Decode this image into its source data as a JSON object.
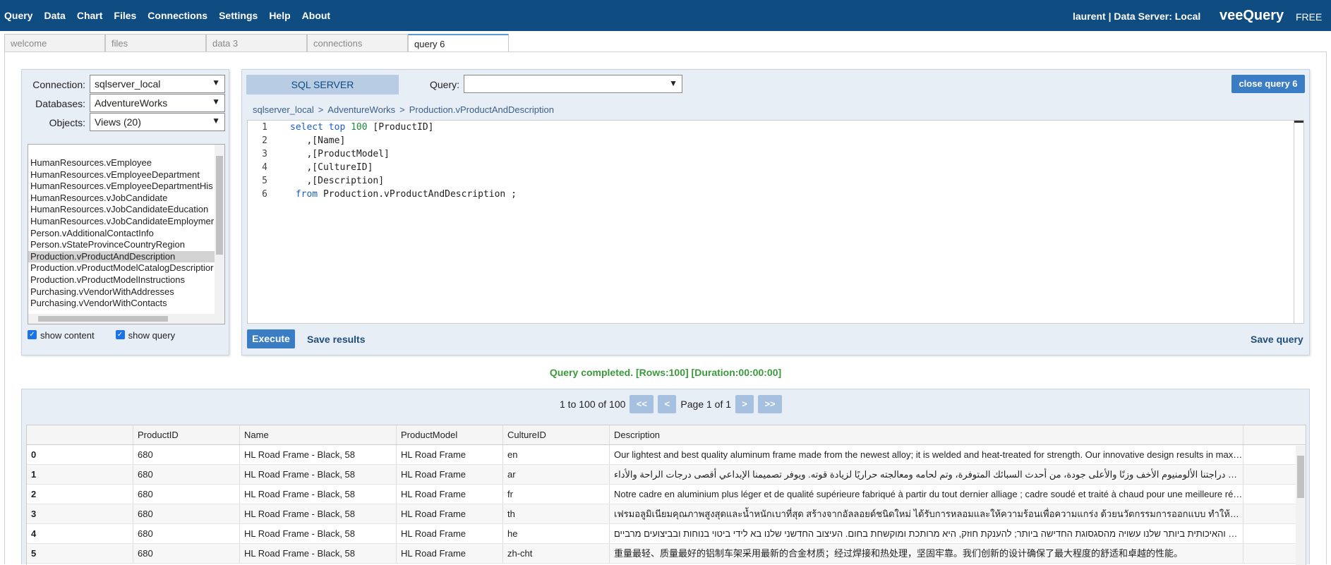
{
  "menu": [
    "Query",
    "Data",
    "Chart",
    "Files",
    "Connections",
    "Settings",
    "Help",
    "About"
  ],
  "user_info": "laurent | Data Server: Local",
  "brand": "veeQuery",
  "edition": "FREE",
  "tabs": [
    {
      "label": "welcome",
      "active": false
    },
    {
      "label": "files",
      "active": false
    },
    {
      "label": "data 3",
      "active": false
    },
    {
      "label": "connections",
      "active": false
    },
    {
      "label": "query 6",
      "active": true
    }
  ],
  "left": {
    "connection_label": "Connection:",
    "connection_value": "sqlserver_local",
    "databases_label": "Databases:",
    "databases_value": "AdventureWorks",
    "objects_label": "Objects:",
    "objects_value": "Views (20)",
    "objects": [
      "HumanResources.vEmployee",
      "HumanResources.vEmployeeDepartment",
      "HumanResources.vEmployeeDepartmentHis",
      "HumanResources.vJobCandidate",
      "HumanResources.vJobCandidateEducation",
      "HumanResources.vJobCandidateEmploymer",
      "Person.vAdditionalContactInfo",
      "Person.vStateProvinceCountryRegion",
      "Production.vProductAndDescription",
      "Production.vProductModelCatalogDescriptior",
      "Production.vProductModelInstructions",
      "Purchasing.vVendorWithAddresses",
      "Purchasing.vVendorWithContacts"
    ],
    "selected_object": "Production.vProductAndDescription",
    "show_content": "show content",
    "show_query": "show query"
  },
  "editor": {
    "db_type": "SQL SERVER",
    "query_label": "Query:",
    "query_value": "",
    "close_label": "close query 6",
    "breadcrumb": [
      "sqlserver_local",
      ">",
      "AdventureWorks",
      ">",
      "Production.vProductAndDescription"
    ],
    "code": [
      {
        "n": "1",
        "kw": "select top",
        "num": "100",
        "rest": " [ProductID]",
        "indent": ""
      },
      {
        "n": "2",
        "kw": "",
        "num": "",
        "rest": ",[Name]",
        "indent": "   "
      },
      {
        "n": "3",
        "kw": "",
        "num": "",
        "rest": ",[ProductModel]",
        "indent": "   "
      },
      {
        "n": "4",
        "kw": "",
        "num": "",
        "rest": ",[CultureID]",
        "indent": "   "
      },
      {
        "n": "5",
        "kw": "",
        "num": "",
        "rest": ",[Description]",
        "indent": "   "
      },
      {
        "n": "6",
        "kw": "from",
        "num": "",
        "rest": " Production.vProductAndDescription ;",
        "indent": " "
      }
    ],
    "execute_label": "Execute",
    "save_results_label": "Save results",
    "save_query_label": "Save query"
  },
  "status": "Query completed. [Rows:100] [Duration:00:00:00]",
  "pager": {
    "range": "1 to 100 of 100",
    "first": "<<",
    "prev": "<",
    "page": "Page 1 of 1",
    "next": ">",
    "last": ">>"
  },
  "grid": {
    "columns": [
      "",
      "ProductID",
      "Name",
      "ProductModel",
      "CultureID",
      "Description",
      ""
    ],
    "rows": [
      [
        "0",
        "680",
        "HL Road Frame - Black, 58",
        "HL Road Frame",
        "en",
        "Our lightest and best quality aluminum frame made from the newest alloy; it is welded and heat-treated for strength. Our innovative design results in maximum comfort and performance."
      ],
      [
        "1",
        "680",
        "HL Road Frame - Black, 58",
        "HL Road Frame",
        "ar",
        "‏لقد تم صناعة هيكل دراجتنا الألومنيوم الأخف وزنًا والأعلى جودة، من أحدث السبائك المتوفرة، وتم لحامه ومعالجته حراريًا لزيادة قوته. ويوفر تصميمنا الإبداعي أقصى درجات الراحة والأداء."
      ],
      [
        "2",
        "680",
        "HL Road Frame - Black, 58",
        "HL Road Frame",
        "fr",
        "Notre cadre en aluminium plus léger et de qualité supérieure fabriqué à partir du tout dernier alliage ; cadre soudé et traité à chaud pour une meilleure résistance."
      ],
      [
        "3",
        "680",
        "HL Road Frame - Black, 58",
        "HL Road Frame",
        "th",
        "เฟรมอลูมิเนียมคุณภาพสูงสุดและน้ำหนักเบาที่สุด สร้างจากอัลลอยด์ชนิดใหม่ ได้รับการหลอมและให้ความร้อนเพื่อความแกร่ง ด้วยนวัตกรรมการออกแบบ ทำให้มีความสบายสูงสุด"
      ],
      [
        "4",
        "680",
        "HL Road Frame - Black, 58",
        "HL Road Frame",
        "he",
        "מיניום הקלה והאיכותית ביותר שלנו עשויה מהסגסוגת החדישה ביותר; להענקת חוזק, היא מרותכת ומוקשחת בחום. העיצוב החדשני שלנו בא לידי ביטוי בנוחות ובביצועים מרביים"
      ],
      [
        "5",
        "680",
        "HL Road Frame - Black, 58",
        "HL Road Frame",
        "zh-cht",
        "重量最轻、质量最好的铝制车架采用最新的合金材质；经过焊接和热处理，坚固牢靠。我们创新的设计确保了最大程度的舒适和卓越的性能。"
      ]
    ]
  }
}
